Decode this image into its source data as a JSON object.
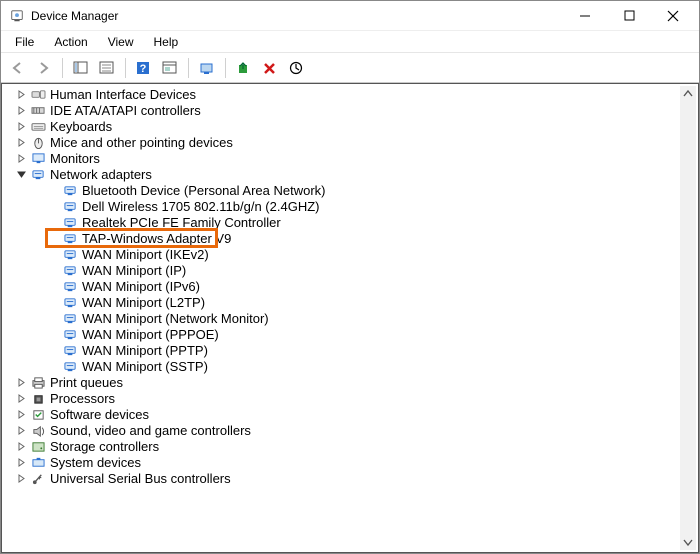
{
  "window": {
    "title": "Device Manager"
  },
  "menu": {
    "file": "File",
    "action": "Action",
    "view": "View",
    "help": "Help"
  },
  "tree": {
    "nodes": [
      {
        "label": "Human Interface Devices",
        "depth": 0,
        "caret": "right",
        "icon": "hid"
      },
      {
        "label": "IDE ATA/ATAPI controllers",
        "depth": 0,
        "caret": "right",
        "icon": "ide"
      },
      {
        "label": "Keyboards",
        "depth": 0,
        "caret": "right",
        "icon": "keyboard"
      },
      {
        "label": "Mice and other pointing devices",
        "depth": 0,
        "caret": "right",
        "icon": "mouse"
      },
      {
        "label": "Monitors",
        "depth": 0,
        "caret": "right",
        "icon": "monitor"
      },
      {
        "label": "Network adapters",
        "depth": 0,
        "caret": "down",
        "icon": "net"
      },
      {
        "label": "Bluetooth Device (Personal Area Network)",
        "depth": 1,
        "caret": "",
        "icon": "net"
      },
      {
        "label": "Dell Wireless 1705 802.11b/g/n (2.4GHZ)",
        "depth": 1,
        "caret": "",
        "icon": "net"
      },
      {
        "label": "Realtek PCIe FE Family Controller",
        "depth": 1,
        "caret": "",
        "icon": "net"
      },
      {
        "label": "TAP-Windows Adapter V9",
        "depth": 1,
        "caret": "",
        "icon": "net",
        "highlight": true
      },
      {
        "label": "WAN Miniport (IKEv2)",
        "depth": 1,
        "caret": "",
        "icon": "net"
      },
      {
        "label": "WAN Miniport (IP)",
        "depth": 1,
        "caret": "",
        "icon": "net"
      },
      {
        "label": "WAN Miniport (IPv6)",
        "depth": 1,
        "caret": "",
        "icon": "net"
      },
      {
        "label": "WAN Miniport (L2TP)",
        "depth": 1,
        "caret": "",
        "icon": "net"
      },
      {
        "label": "WAN Miniport (Network Monitor)",
        "depth": 1,
        "caret": "",
        "icon": "net"
      },
      {
        "label": "WAN Miniport (PPPOE)",
        "depth": 1,
        "caret": "",
        "icon": "net"
      },
      {
        "label": "WAN Miniport (PPTP)",
        "depth": 1,
        "caret": "",
        "icon": "net"
      },
      {
        "label": "WAN Miniport (SSTP)",
        "depth": 1,
        "caret": "",
        "icon": "net"
      },
      {
        "label": "Print queues",
        "depth": 0,
        "caret": "right",
        "icon": "print"
      },
      {
        "label": "Processors",
        "depth": 0,
        "caret": "right",
        "icon": "cpu"
      },
      {
        "label": "Software devices",
        "depth": 0,
        "caret": "right",
        "icon": "soft"
      },
      {
        "label": "Sound, video and game controllers",
        "depth": 0,
        "caret": "right",
        "icon": "sound"
      },
      {
        "label": "Storage controllers",
        "depth": 0,
        "caret": "right",
        "icon": "storage"
      },
      {
        "label": "System devices",
        "depth": 0,
        "caret": "right",
        "icon": "system"
      },
      {
        "label": "Universal Serial Bus controllers",
        "depth": 0,
        "caret": "right",
        "icon": "usb"
      }
    ]
  }
}
